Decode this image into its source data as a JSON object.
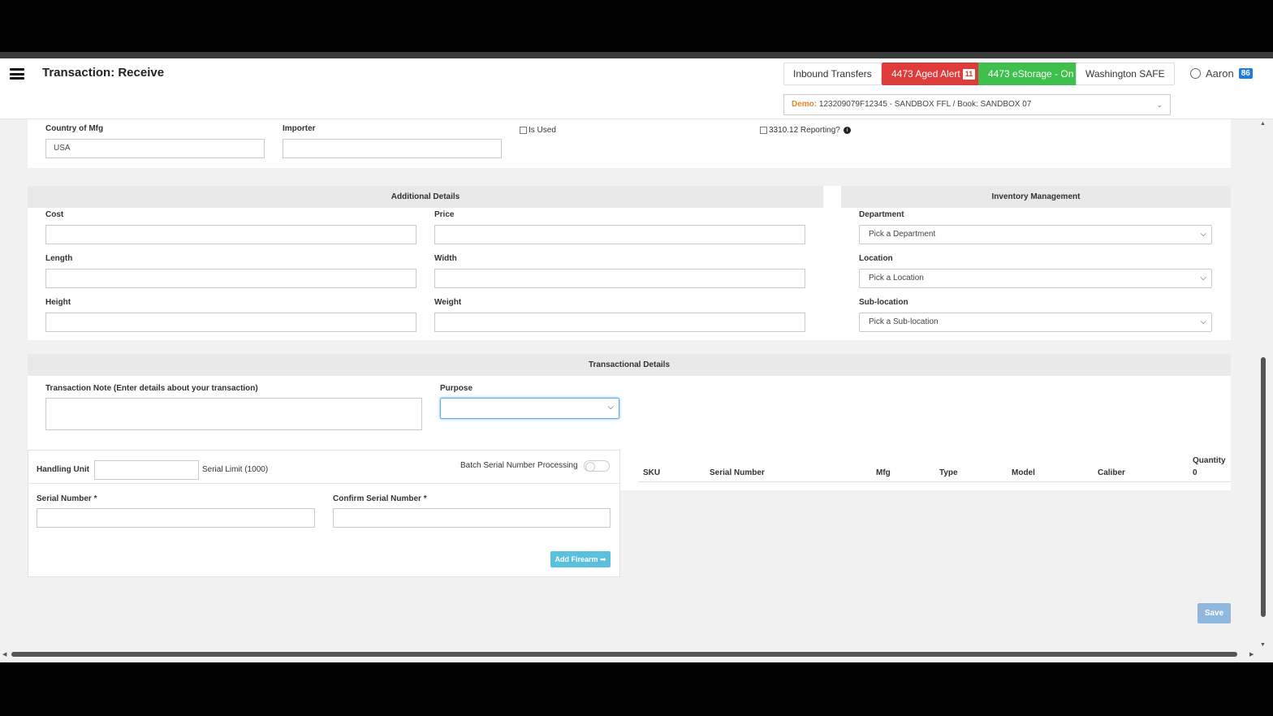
{
  "header": {
    "title": "Transaction: Receive",
    "buttons": {
      "inbound": "Inbound Transfers",
      "aged": "4473 Aged Alert",
      "aged_count": "11",
      "estorage": "4473 eStorage - On",
      "washington": "Washington SAFE"
    },
    "user": {
      "name": "Aaron",
      "badge": "86"
    },
    "demo": {
      "label": "Demo:",
      "value": "123209079F12345 - SANDBOX FFL / Book: SANDBOX 07"
    }
  },
  "top_fields": {
    "country_label": "Country of Mfg",
    "country_value": "USA",
    "importer_label": "Importer",
    "is_used": "Is Used",
    "reporting": "3310.12 Reporting?"
  },
  "additional": {
    "heading": "Additional Details",
    "cost": "Cost",
    "price": "Price",
    "length": "Length",
    "width": "Width",
    "height": "Height",
    "weight": "Weight"
  },
  "inventory": {
    "heading": "Inventory Management",
    "department_label": "Department",
    "department_value": "Pick a Department",
    "location_label": "Location",
    "location_value": "Pick a Location",
    "sublocation_label": "Sub-location",
    "sublocation_value": "Pick a Sub-location"
  },
  "transactional": {
    "heading": "Transactional Details",
    "note_label": "Transaction Note",
    "note_hint": "(Enter details about your transaction)",
    "purpose_label": "Purpose"
  },
  "serial": {
    "handling_label": "Handling Unit",
    "limit": "Serial Limit (1000)",
    "batch_label": "Batch Serial Number Processing",
    "serial_label": "Serial Number *",
    "confirm_label": "Confirm Serial Number *",
    "add_button": "Add Firearm"
  },
  "table": {
    "headers": [
      "SKU",
      "Serial Number",
      "Mfg",
      "Type",
      "Model",
      "Caliber"
    ],
    "quantity_label": "Quantity",
    "quantity_value": "0"
  },
  "save_label": "Save"
}
